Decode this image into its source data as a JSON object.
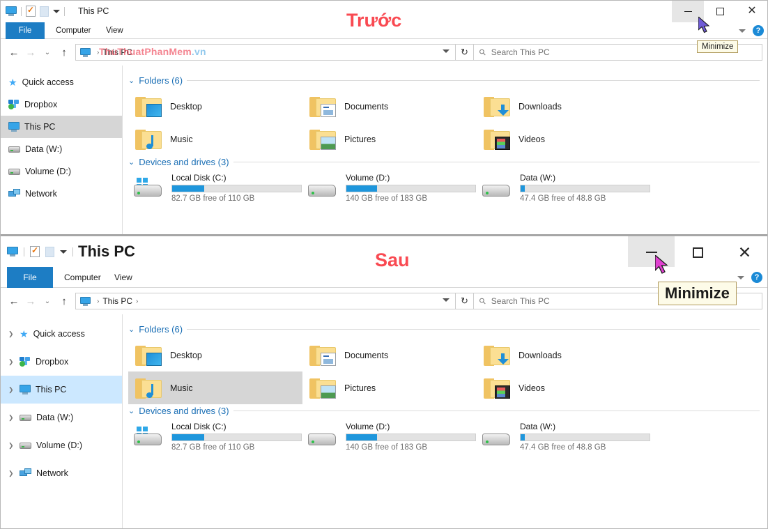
{
  "window_top": {
    "label": "Trước",
    "title": "This PC",
    "tabs": {
      "file": "File",
      "computer": "Computer",
      "view": "View"
    },
    "address": {
      "crumb": "This PC",
      "watermark": "ThuThuatPhanMem",
      "watermark_tld": ".vn"
    },
    "search": {
      "placeholder": "Search This PC"
    },
    "caption": {
      "minimize": "—",
      "maximize": "□",
      "close": "✕"
    },
    "tooltip": "Minimize",
    "sidebar": [
      {
        "label": "Quick access",
        "icon": "star-icon",
        "selected": false
      },
      {
        "label": "Dropbox",
        "icon": "dropbox-icon",
        "selected": false
      },
      {
        "label": "This PC",
        "icon": "pc-icon",
        "selected": true
      },
      {
        "label": "Data (W:)",
        "icon": "hdd-icon",
        "selected": false
      },
      {
        "label": "Volume (D:)",
        "icon": "hdd-icon",
        "selected": false
      },
      {
        "label": "Network",
        "icon": "network-icon",
        "selected": false
      }
    ],
    "folders_group": "Folders (6)",
    "folders": [
      {
        "label": "Desktop",
        "icon": "folder-desktop-icon",
        "selected": false
      },
      {
        "label": "Documents",
        "icon": "folder-documents-icon",
        "selected": false
      },
      {
        "label": "Downloads",
        "icon": "folder-downloads-icon",
        "selected": false
      },
      {
        "label": "Music",
        "icon": "folder-music-icon",
        "selected": false
      },
      {
        "label": "Pictures",
        "icon": "folder-pictures-icon",
        "selected": false
      },
      {
        "label": "Videos",
        "icon": "folder-videos-icon",
        "selected": false
      }
    ],
    "drives_group": "Devices and drives (3)",
    "drives": [
      {
        "name": "Local Disk (C:)",
        "free": "82.7 GB free of 110 GB",
        "used_pct": 25,
        "system": true
      },
      {
        "name": "Volume (D:)",
        "free": "140 GB free of 183 GB",
        "used_pct": 24,
        "system": false
      },
      {
        "name": "Data (W:)",
        "free": "47.4 GB free of 48.8 GB",
        "used_pct": 3,
        "system": false
      }
    ]
  },
  "window_bottom": {
    "label": "Sau",
    "title": "This PC",
    "tabs": {
      "file": "File",
      "computer": "Computer",
      "view": "View"
    },
    "address": {
      "crumb": "This PC"
    },
    "search": {
      "placeholder": "Search This PC"
    },
    "caption": {
      "minimize": "—",
      "maximize": "□",
      "close": "✕"
    },
    "tooltip": "Minimize",
    "sidebar": [
      {
        "label": "Quick access",
        "icon": "star-icon",
        "selected": false
      },
      {
        "label": "Dropbox",
        "icon": "dropbox-icon",
        "selected": false
      },
      {
        "label": "This PC",
        "icon": "pc-icon",
        "selected": true
      },
      {
        "label": "Data (W:)",
        "icon": "hdd-icon",
        "selected": false
      },
      {
        "label": "Volume (D:)",
        "icon": "hdd-icon",
        "selected": false
      },
      {
        "label": "Network",
        "icon": "network-icon",
        "selected": false
      }
    ],
    "folders_group": "Folders (6)",
    "folders": [
      {
        "label": "Desktop",
        "icon": "folder-desktop-icon",
        "selected": false
      },
      {
        "label": "Documents",
        "icon": "folder-documents-icon",
        "selected": false
      },
      {
        "label": "Downloads",
        "icon": "folder-downloads-icon",
        "selected": false
      },
      {
        "label": "Music",
        "icon": "folder-music-icon",
        "selected": true
      },
      {
        "label": "Pictures",
        "icon": "folder-pictures-icon",
        "selected": false
      },
      {
        "label": "Videos",
        "icon": "folder-videos-icon",
        "selected": false
      }
    ],
    "drives_group": "Devices and drives (3)",
    "drives": [
      {
        "name": "Local Disk (C:)",
        "free": "82.7 GB free of 110 GB",
        "used_pct": 25,
        "system": true
      },
      {
        "name": "Volume (D:)",
        "free": "140 GB free of 183 GB",
        "used_pct": 24,
        "system": false
      },
      {
        "name": "Data (W:)",
        "free": "47.4 GB free of 48.8 GB",
        "used_pct": 3,
        "system": false
      }
    ]
  },
  "colors": {
    "accent_red": "#f94a52",
    "file_tab_blue": "#1d7dc4",
    "group_header_blue": "#1b6fb5",
    "selection_grey": "#d6d6d6",
    "selection_blue": "#cce8ff",
    "drive_bar_blue": "#1e96dc",
    "tooltip_bg": "#fdfbe8"
  }
}
